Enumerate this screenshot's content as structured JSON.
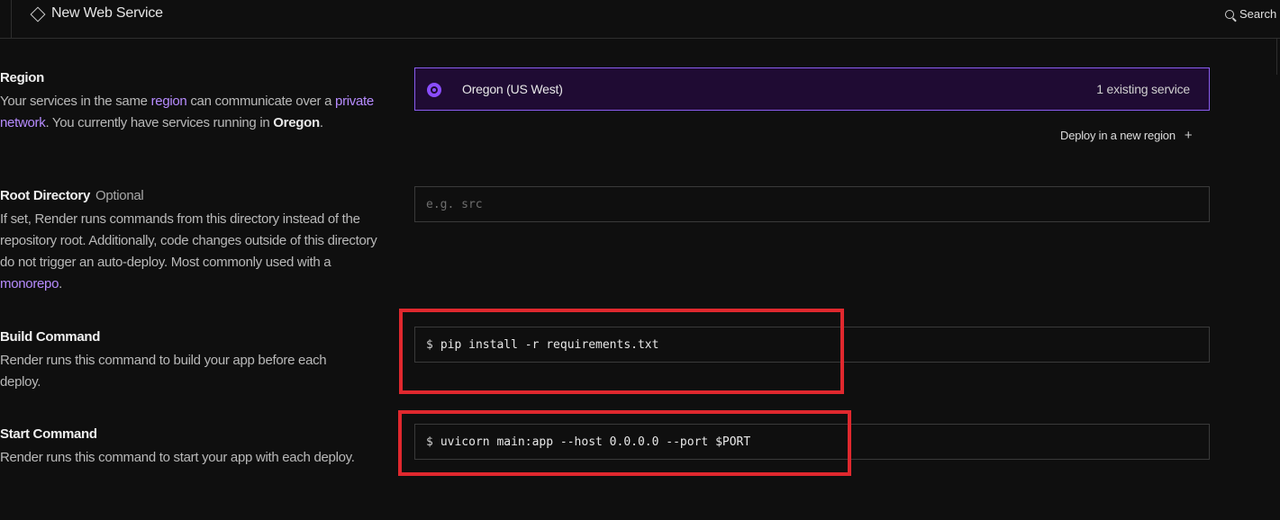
{
  "header": {
    "title": "New Web Service",
    "search_label": "Search"
  },
  "region": {
    "heading": "Region",
    "desc_1": "Your services in the same ",
    "desc_link_1": "region",
    "desc_2": " can communicate over a ",
    "desc_link_2": "private network",
    "desc_3": ". You currently have services running in ",
    "desc_strong": "Oregon",
    "desc_4": ".",
    "selected_name": "Oregon (US West)",
    "selected_count": "1 existing service",
    "deploy_new_label": "Deploy in a new region",
    "deploy_new_icon": "+"
  },
  "root_directory": {
    "heading": "Root Directory",
    "optional_label": "Optional",
    "desc_1": "If set, Render runs commands from this directory instead of the repository root. Additionally, code changes outside of this directory do not trigger an auto-deploy. Most commonly used with a ",
    "desc_link": "monorepo",
    "desc_2": ".",
    "placeholder": "e.g. src"
  },
  "build_command": {
    "heading": "Build Command",
    "desc": "Render runs this command to build your app before each deploy.",
    "prompt": "$",
    "value": "pip install -r requirements.txt"
  },
  "start_command": {
    "heading": "Start Command",
    "desc": "Render runs this command to start your app with each deploy.",
    "prompt": "$",
    "value": "uvicorn main:app --host 0.0.0.0 --port $PORT"
  },
  "colors": {
    "accent": "#8a4dff",
    "selected_bg": "#1f0b33",
    "link": "#b78cff",
    "highlight": "#e0282e"
  }
}
